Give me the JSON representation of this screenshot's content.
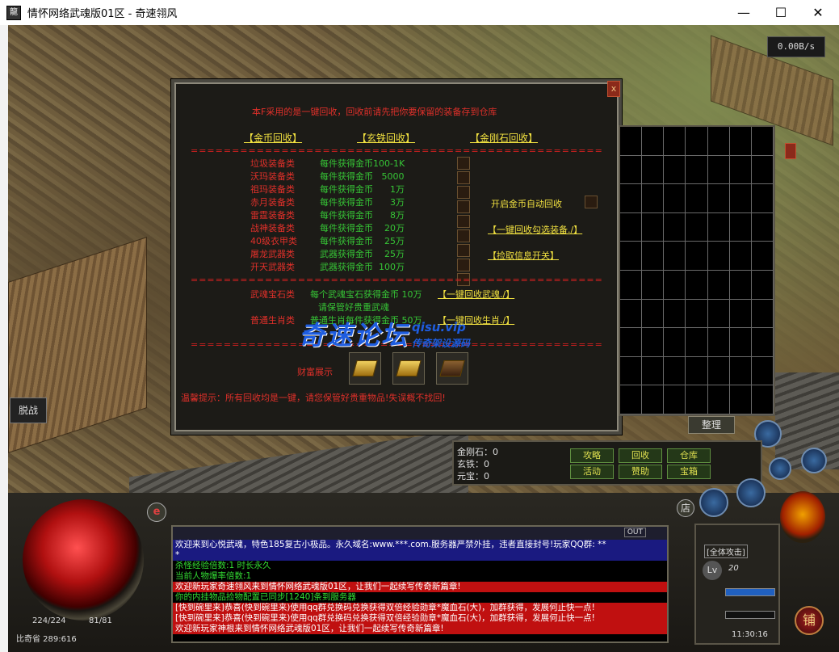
{
  "window": {
    "title": "情怀网络武魂版01区 - 奇速翎风",
    "icon_label": "龍",
    "minimize": "—",
    "maximize": "☐",
    "close": "✕"
  },
  "net_speed": "0.00B/s",
  "panel": {
    "notice": "本F采用的是一键回收，回收前请先把你要保留的装备存到仓库",
    "tabs": [
      "【金币回收】",
      "【玄铁回收】",
      "【金刚石回收】"
    ],
    "dash_line": "========================================================================",
    "rows": [
      {
        "name": "垃圾装备类",
        "desc": "每件获得金币100-1K"
      },
      {
        "name": "沃玛装备类",
        "desc": "每件获得金币   5000"
      },
      {
        "name": "祖玛装备类",
        "desc": "每件获得金币      1万"
      },
      {
        "name": "赤月装备类",
        "desc": "每件获得金币      3万"
      },
      {
        "name": "雷霆装备类",
        "desc": "每件获得金币      8万"
      },
      {
        "name": "战神装备类",
        "desc": "每件获得金币    20万"
      },
      {
        "name": "40级衣甲类",
        "desc": "每件获得金币    25万"
      },
      {
        "name": "屠龙武器类",
        "desc": "武器获得金币    25万"
      },
      {
        "name": "开天武器类",
        "desc": "武器获得金币  100万"
      }
    ],
    "auto_recycle_label": "开启金币自动回收",
    "one_key_select": "【一键回收勾选装备./】",
    "pickup_toggle": "【捡取信息开关】",
    "weapon_gem_label": "武魂宝石类",
    "weapon_gem_desc": "每个武魂宝石获得金币  10万",
    "weapon_gem_btn": "【一键回收武魂./】",
    "keep_notice": "请保管好贵重武魂",
    "zodiac_label": "普通生肖类",
    "zodiac_desc": "普通生肖每件获得金币  50万",
    "zodiac_btn": "【一键回收生肖./】",
    "wealth_label": "财富展示",
    "warm_tip": "温馨提示：所有回收均是一键，请您保管好贵重物品!失误概不找回!",
    "close": "x"
  },
  "watermark": {
    "main": "奇速论坛",
    "url": "qisu.vip",
    "sub": "传奇架设源码"
  },
  "bag": {
    "sort_button": "整理",
    "rows": 10,
    "cols": 7
  },
  "currency": {
    "diamond": "金刚石：0",
    "iron": "玄铁：0",
    "yuanbao": "元宝：0",
    "buttons": [
      "攻略",
      "回收",
      "仓库",
      "活动",
      "赞助",
      "宝箱"
    ]
  },
  "hud": {
    "left_label": "脱战",
    "hp": "224/224",
    "mp": "81/81",
    "location": "比奇省  289:616",
    "attack_mode": "[全体攻击]",
    "level": "20",
    "time": "11:30:16",
    "shop": "店",
    "shop2": "铺",
    "out_btn": "OUT",
    "e_btn": "e"
  },
  "chat": [
    {
      "text": "欢迎来到心悦武魂，特色185复古小极品。永久域名:www.***.com.服务器严禁外挂，违者直接封号!玩家QQ群: **",
      "color": "#ffffff",
      "bg": "#1a1a80"
    },
    {
      "text": "*",
      "color": "#ffffff",
      "bg": "#1a1a80"
    },
    {
      "text": "杀怪经验倍数:1 时长永久",
      "color": "#33dd33",
      "bg": "#000"
    },
    {
      "text": "当前人物爆率倍数:1",
      "color": "#33dd33",
      "bg": "#000"
    },
    {
      "text": "欢迎新玩家奇速翎风来到情怀网络武魂版01区，让我们一起续写传奇新篇章!",
      "color": "#ffffff",
      "bg": "#c01010"
    },
    {
      "text": "你的内挂物品捡物配置已同步[1240]条到服务器",
      "color": "#33dd33",
      "bg": "#000"
    },
    {
      "text": "[快到碗里来]恭喜(快到碗里来)使用qq群兑换码兑换获得双倍经验勋章*魔血石(大)，加群获得，发展何止快一点!",
      "color": "#ffffff",
      "bg": "#c01010"
    },
    {
      "text": "[快到碗里来]恭喜(快到碗里来)使用qq群兑换码兑换获得双倍经验勋章*魔血石(大)，加群获得，发展何止快一点!",
      "color": "#ffffff",
      "bg": "#c01010"
    },
    {
      "text": "欢迎新玩家神根来到情怀网络武魂版01区，让我们一起续写传奇新篇章!",
      "color": "#ffffff",
      "bg": "#c01010"
    }
  ]
}
